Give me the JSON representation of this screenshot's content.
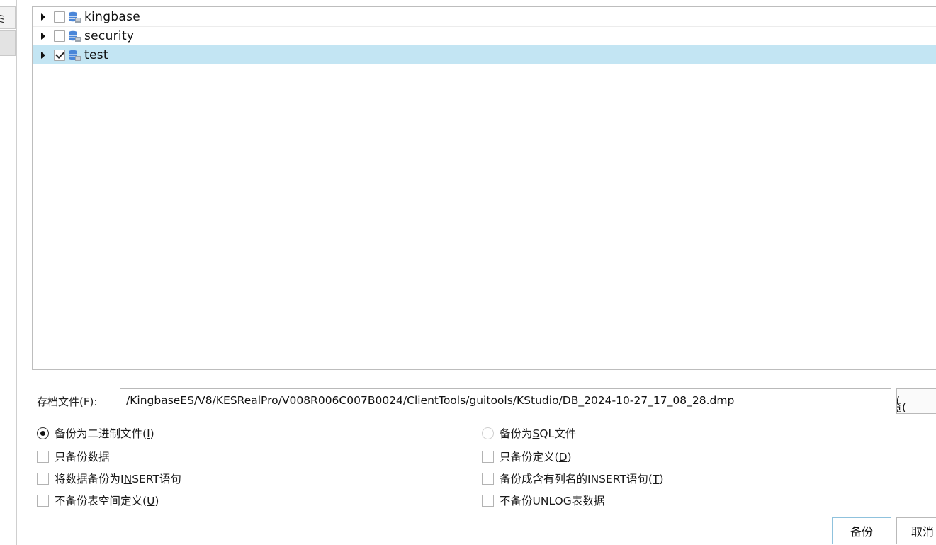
{
  "sidebar": {
    "clipped_label": "ミ"
  },
  "tree": {
    "items": [
      {
        "label": "kingbase",
        "checked": false,
        "selected": false,
        "icon": "database-icon"
      },
      {
        "label": "security",
        "checked": false,
        "selected": false,
        "icon": "database-icon"
      },
      {
        "label": "test",
        "checked": true,
        "selected": true,
        "icon": "database-icon"
      }
    ]
  },
  "archive": {
    "label": "存档文件(F):",
    "path": "/KingbaseES/V8/KESRealPro/V008R006C007B0024/ClientTools/guitools/KStudio/DB_2024-10-27_17_08_28.dmp",
    "browse_prefix": "刘览(",
    "browse_mnemonic": "W",
    "browse_suffix": ")"
  },
  "options": {
    "binary": {
      "prefix": "备份为二进制文件(",
      "mnemonic": "I",
      "suffix": ")",
      "selected": true
    },
    "sql": {
      "prefix": "备份为",
      "mnemonic": "S",
      "suffix": "QL文件",
      "selected": false
    },
    "data_only": {
      "text": "只备份数据",
      "checked": false
    },
    "definition_only": {
      "prefix": "只备份定义(",
      "mnemonic": "D",
      "suffix": ")",
      "checked": false
    },
    "insert": {
      "prefix": "将数据备份为I",
      "mnemonic": "N",
      "suffix": "SERT语句",
      "checked": false
    },
    "insert_columns": {
      "prefix": "备份成含有列名的INSERT语句(",
      "mnemonic": "T",
      "suffix": ")",
      "checked": false
    },
    "no_tablespace": {
      "prefix": "不备份表空间定义(",
      "mnemonic": "U",
      "suffix": ")",
      "checked": false
    },
    "no_unlog": {
      "text": "不备份UNLOG表数据",
      "checked": false
    }
  },
  "buttons": {
    "backup": "备份",
    "cancel": "取消"
  },
  "colors": {
    "selection": "#c3e5f3",
    "db_icon_blue": "#4a86d8",
    "db_icon_gray": "#9aa3ad",
    "focus_border": "#8fc2dd"
  }
}
